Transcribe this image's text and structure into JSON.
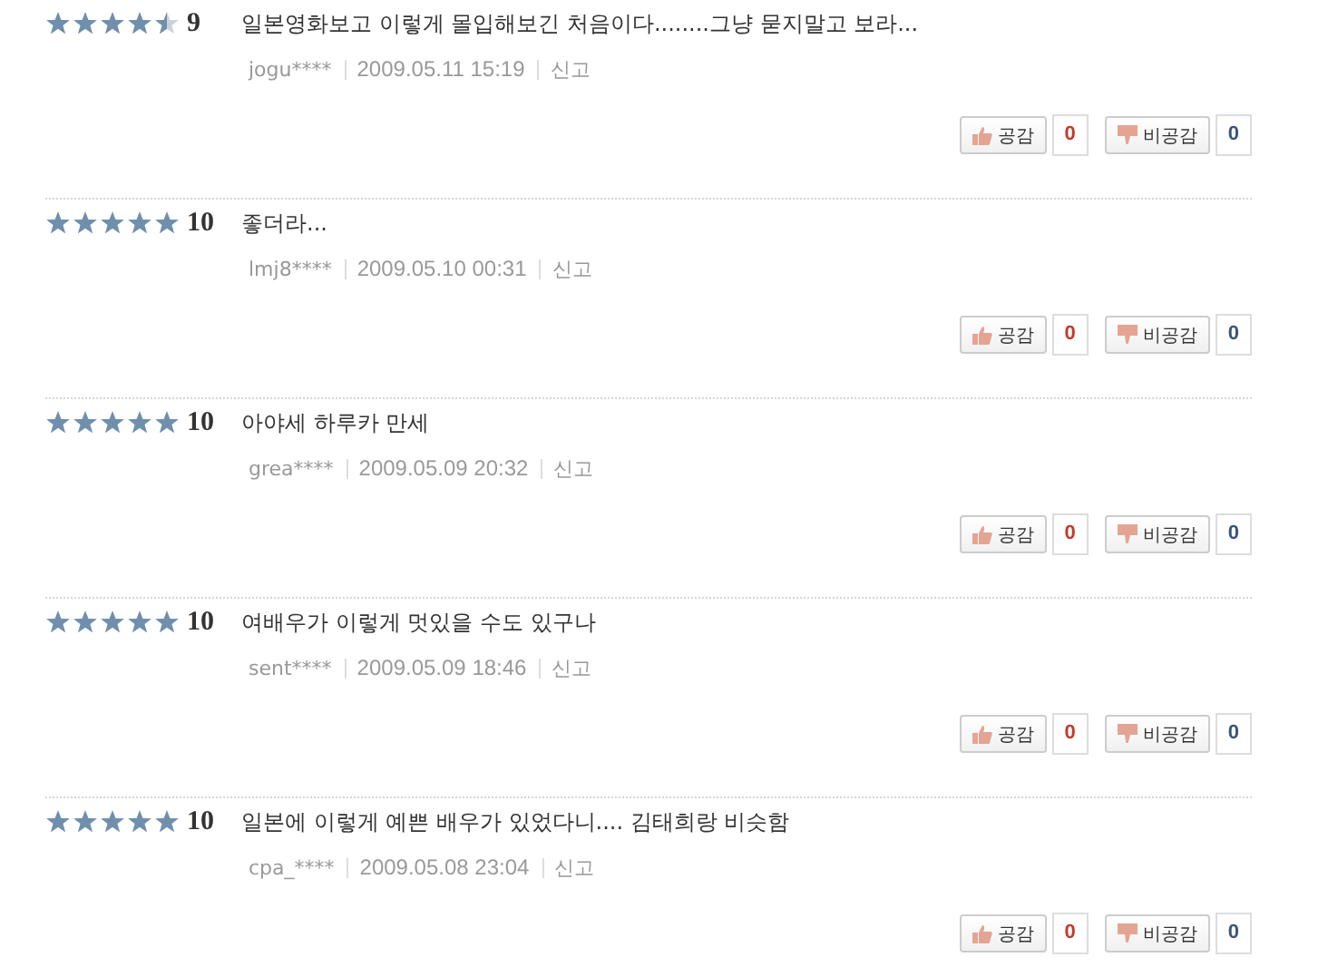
{
  "reviews": [
    {
      "stars": 4.5,
      "score": "9",
      "text": "일본영화보고 이렇게 몰입해보긴 처음이다........그냥 묻지말고 보라...",
      "user": "jogu****",
      "date": "2009.05.11 15:19",
      "report": "신고",
      "like_label": "공감",
      "like_count": "0",
      "dislike_label": "비공감",
      "dislike_count": "0"
    },
    {
      "stars": 5,
      "score": "10",
      "text": "좋더라...",
      "user": "lmj8****",
      "date": "2009.05.10 00:31",
      "report": "신고",
      "like_label": "공감",
      "like_count": "0",
      "dislike_label": "비공감",
      "dislike_count": "0"
    },
    {
      "stars": 5,
      "score": "10",
      "text": "아야세 하루카 만세",
      "user": "grea****",
      "date": "2009.05.09 20:32",
      "report": "신고",
      "like_label": "공감",
      "like_count": "0",
      "dislike_label": "비공감",
      "dislike_count": "0"
    },
    {
      "stars": 5,
      "score": "10",
      "text": "여배우가 이렇게 멋있을 수도 있구나",
      "user": "sent****",
      "date": "2009.05.09 18:46",
      "report": "신고",
      "like_label": "공감",
      "like_count": "0",
      "dislike_label": "비공감",
      "dislike_count": "0"
    },
    {
      "stars": 5,
      "score": "10",
      "text": "일본에 이렇게 예쁜 배우가 있었다니.... 김태희랑 비슷함",
      "user": "cpa_****",
      "date": "2009.05.08 23:04",
      "report": "신고",
      "like_label": "공감",
      "like_count": "0",
      "dislike_label": "비공감",
      "dislike_count": "0"
    }
  ]
}
